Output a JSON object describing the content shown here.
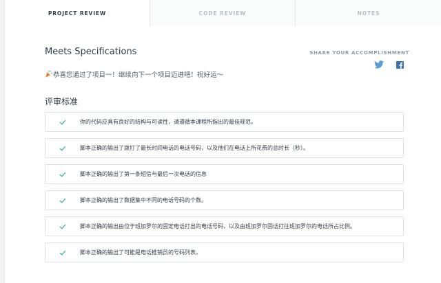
{
  "tabs": [
    {
      "label": "PROJECT REVIEW",
      "active": true
    },
    {
      "label": "CODE REVIEW",
      "active": false
    },
    {
      "label": "NOTES",
      "active": false
    }
  ],
  "review": {
    "title": "Meets Specifications",
    "share_label": "SHARE YOUR ACCOMPLISHMENT",
    "congrats_message": "恭喜您通过了项目一！继续向下一个项目迈进吧！祝好运～",
    "criteria_heading": "评审标准"
  },
  "criteria": [
    {
      "text": "你的代码应具有良好的结构与可读性，请遵循本课程所指出的最佳规范。"
    },
    {
      "text": "脚本正确的输出了拨打了最长时间电话的电话号码，以及他们在电话上所花费的总时长（秒）。"
    },
    {
      "text": "脚本正确的输出了第一条短信与最后一次电话的信息"
    },
    {
      "text": "脚本正确的输出了数据集中不同的电话号码的个数。"
    },
    {
      "text": "脚本正确的输出由位于班加罗尔的固定电话打出的电话号码，以及由班加罗尔固话打往班加罗尔的电话所占比例。"
    },
    {
      "text": "脚本正确的输出了可能是电话推销员的号码列表。"
    }
  ],
  "colors": {
    "check": "#34b79c",
    "twitter": "#5a9fd6",
    "facebook": "#3b6fb6",
    "text": "#2e3d49",
    "muted": "#8a9ba8"
  },
  "icons": {
    "share_twitter": "twitter-icon",
    "share_facebook": "facebook-icon",
    "congrats": "party-popper-icon",
    "criterion": "check-icon"
  }
}
